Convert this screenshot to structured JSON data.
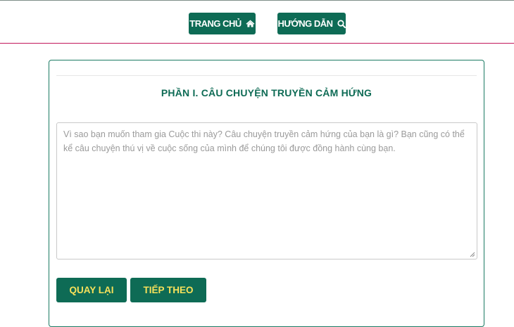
{
  "nav": {
    "home_label": "TRANG CHỦ",
    "home_icon": "home-icon",
    "guide_label": "HƯỚNG DẪN",
    "guide_icon": "search-icon"
  },
  "section": {
    "title": "PHẦN I. CÂU CHUYỆN TRUYỀN CẢM HỨNG"
  },
  "story": {
    "value": "",
    "placeholder": "Vì sao bạn muốn tham gia Cuộc thi này? Câu chuyện truyền cảm hứng của bạn là gì? Bạn cũng có thể kể câu chuyện thú vị về cuộc sống của mình để chúng tôi được đồng hành cùng bạn."
  },
  "actions": {
    "back_label": "QUAY LẠI",
    "next_label": "TIẾP THEO"
  },
  "colors": {
    "primary": "#0e6b55",
    "button_text": "#f7e15a",
    "accent_rule": "#c2185b"
  }
}
